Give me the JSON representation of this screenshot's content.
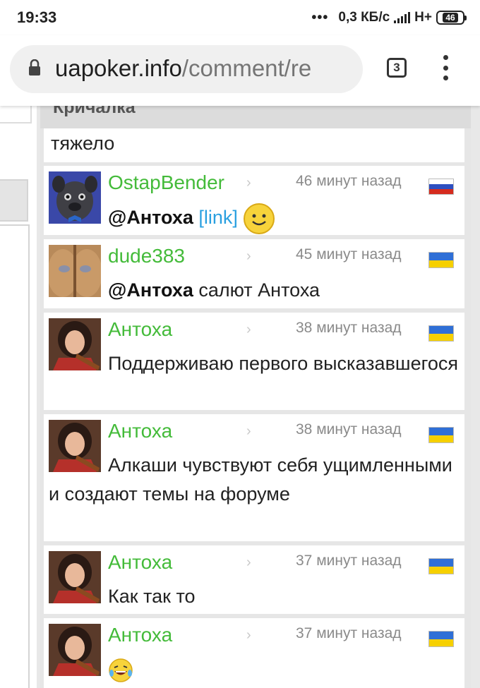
{
  "status_bar": {
    "time": "19:33",
    "dots": "•••",
    "network_speed": "0,3 КБ/с",
    "network_type": "H+",
    "battery_level": "46"
  },
  "browser": {
    "url_host": "uapoker.info",
    "url_path": "/comment/re",
    "tab_count": "3",
    "icons": [
      "lock-icon",
      "tabs-icon",
      "overflow-menu-icon"
    ]
  },
  "panel": {
    "title": "Кричалка",
    "previous_message_tail": "тяжело"
  },
  "colors": {
    "author": "#44bb3a",
    "link": "#2aa0e0",
    "timestamp": "#8a8a8a",
    "flag_ua_blue": "#2f6fd6",
    "flag_ua_yellow": "#f6d000",
    "flag_ru_white": "#ffffff",
    "flag_ru_blue": "#2d4fc0",
    "flag_ru_red": "#d52b1e"
  },
  "comments": [
    {
      "author": "OstapBender",
      "time": "46 минут назад",
      "flag": "ru",
      "mention": "@Антоха",
      "link_text": "[link]",
      "text": "",
      "emoji": "smile-emoji"
    },
    {
      "author": "dude383",
      "time": "45 минут назад",
      "flag": "ua",
      "mention": "@Антоха",
      "text": " салют Антоха"
    },
    {
      "author": "Антоха",
      "time": "38 минут назад",
      "flag": "ua",
      "text": "Поддерживаю первого высказавшегося"
    },
    {
      "author": "Антоха",
      "time": "38 минут назад",
      "flag": "ua",
      "text": "Алкаши чувствуют себя ущимленными и создают темы на форуме"
    },
    {
      "author": "Антоха",
      "time": "37 минут назад",
      "flag": "ua",
      "text": "Как так то"
    },
    {
      "author": "Антоха",
      "time": "37 минут назад",
      "flag": "ua",
      "text": "",
      "emoji": "laughing-tears-emoji"
    }
  ]
}
